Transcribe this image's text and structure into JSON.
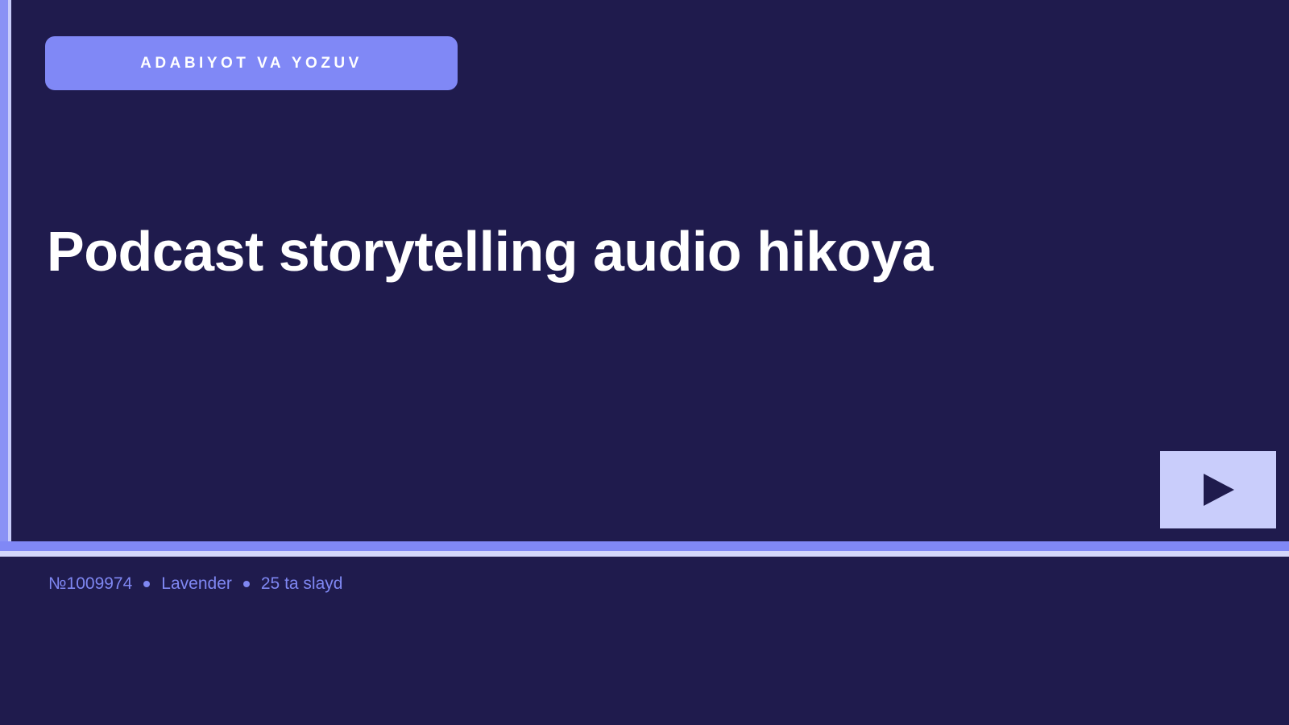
{
  "slide": {
    "category": "ADABIYOT VA YOZUV",
    "title": "Podcast storytelling audio hikoya",
    "play_icon": "play-icon"
  },
  "meta": {
    "id": "№1009974",
    "theme": "Lavender",
    "slides_count": "25 ta slayd"
  },
  "colors": {
    "background": "#1f1b4d",
    "accent": "#8088f6",
    "accent_light": "#c9cdfb",
    "meta_text": "#7f87f2",
    "title_text": "#ffffff"
  }
}
